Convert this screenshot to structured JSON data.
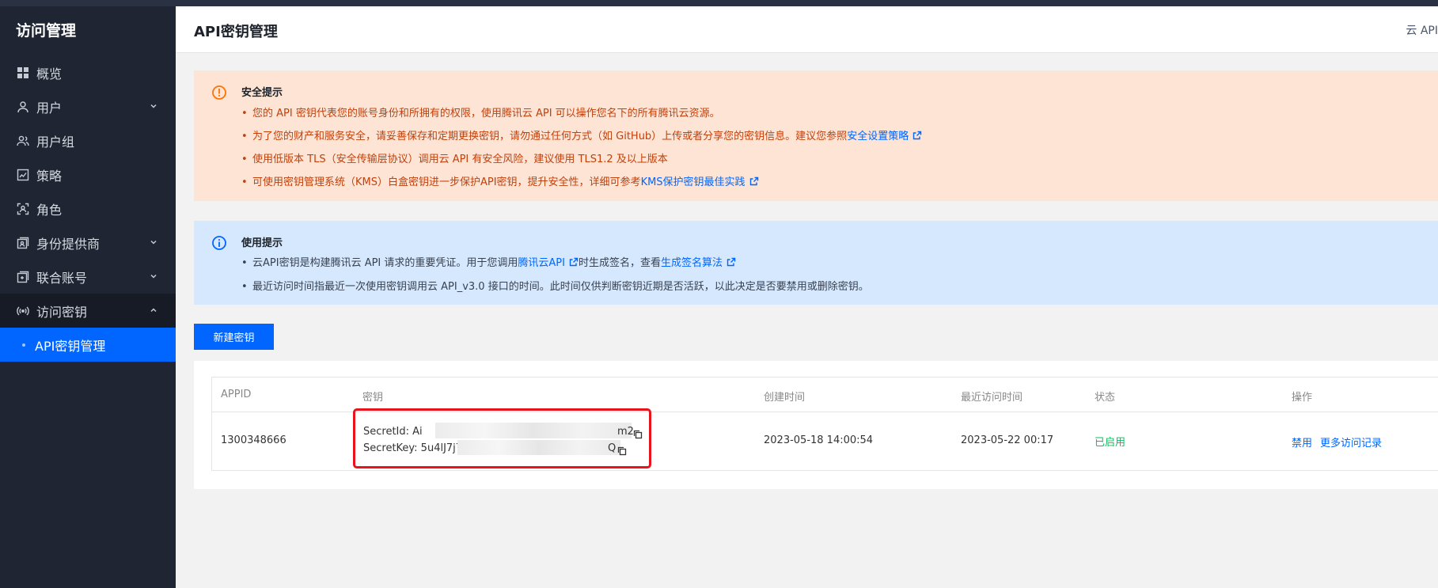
{
  "sidebar": {
    "title": "访问管理",
    "items": [
      {
        "label": "概览"
      },
      {
        "label": "用户"
      },
      {
        "label": "用户组"
      },
      {
        "label": "策略"
      },
      {
        "label": "角色"
      },
      {
        "label": "身份提供商"
      },
      {
        "label": "联合账号"
      },
      {
        "label": "访问密钥"
      }
    ],
    "subitem": "API密钥管理"
  },
  "header": {
    "title": "API密钥管理",
    "right_text": "云 API"
  },
  "security_tip": {
    "title": "安全提示",
    "items": [
      {
        "text": "您的 API 密钥代表您的账号身份和所拥有的权限，使用腾讯云 API 可以操作您名下的所有腾讯云资源。"
      },
      {
        "text": "为了您的财产和服务安全，请妥善保存和定期更换密钥，请勿通过任何方式（如 GitHub）上传或者分享您的密钥信息。建议您参照",
        "link": "安全设置策略"
      },
      {
        "text": "使用低版本 TLS（安全传输层协议）调用云 API 有安全风险，建议使用 TLS1.2 及以上版本"
      },
      {
        "text": "可使用密钥管理系统（KMS）白盒密钥进一步保护API密钥，提升安全性，详细可参考",
        "link": "KMS保护密钥最佳实践"
      }
    ]
  },
  "usage_tip": {
    "title": "使用提示",
    "item1_pre": "云API密钥是构建腾讯云 API 请求的重要凭证。用于您调用",
    "item1_link1": "腾讯云API",
    "item1_mid": "时生成签名，查看",
    "item1_link2": "生成签名算法",
    "item2": "最近访问时间指最近一次使用密钥调用云 API_v3.0 接口的时间。此时间仅供判断密钥近期是否活跃，以此决定是否要禁用或删除密钥。"
  },
  "create_button": "新建密钥",
  "table": {
    "headers": {
      "appid": "APPID",
      "key": "密钥",
      "created": "创建时间",
      "last_access": "最近访问时间",
      "status": "状态",
      "ops": "操作"
    },
    "row": {
      "appid": "1300348666",
      "secret_id_prefix": "SecretId: Ai",
      "secret_id_suffix": "m2",
      "secret_key_prefix": "SecretKey: 5u4lJ7j7",
      "secret_key_suffix": "Q",
      "created": "2023-05-18 14:00:54",
      "last_access": "2023-05-22 00:17",
      "status": "已启用",
      "op_disable": "禁用",
      "op_more": "更多访问记录"
    }
  },
  "colors": {
    "sidebar_bg": "#1f2532",
    "accent": "#0066ff",
    "warn_bg": "#fde4d4",
    "warn_text": "#c2410c",
    "info_bg": "#d6e8fd",
    "status_green": "#0abf5b",
    "highlight_red": "#e8141c"
  }
}
